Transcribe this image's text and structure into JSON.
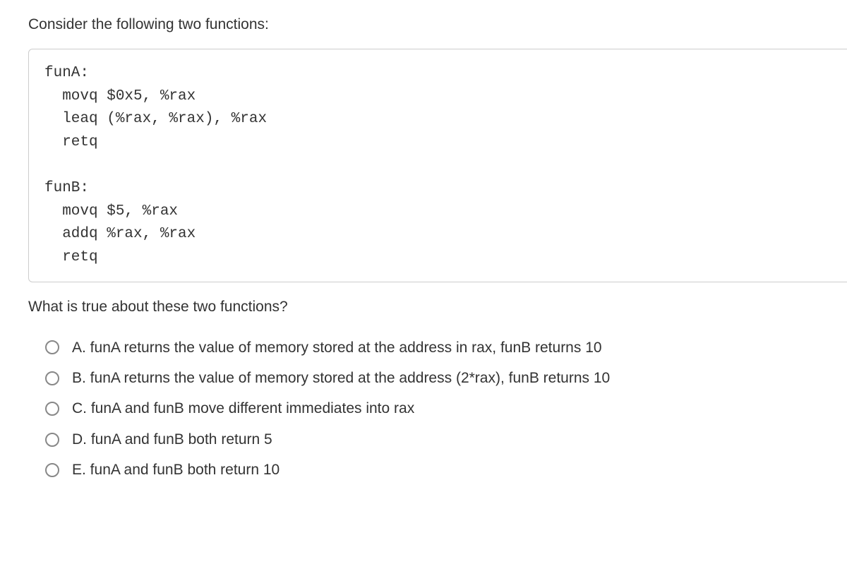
{
  "prompt": "Consider the following two functions:",
  "code": "funA:\n  movq $0x5, %rax\n  leaq (%rax, %rax), %rax\n  retq\n\nfunB:\n  movq $5, %rax\n  addq %rax, %rax\n  retq",
  "question": "What is true about these two functions?",
  "options": [
    {
      "label": "A. funA returns the value of memory stored at the address in rax, funB returns 10"
    },
    {
      "label": "B. funA returns the value of memory stored at the address (2*rax), funB returns 10"
    },
    {
      "label": "C. funA and funB move different immediates into rax"
    },
    {
      "label": "D. funA and funB both return 5"
    },
    {
      "label": "E. funA and funB both return 10"
    }
  ]
}
